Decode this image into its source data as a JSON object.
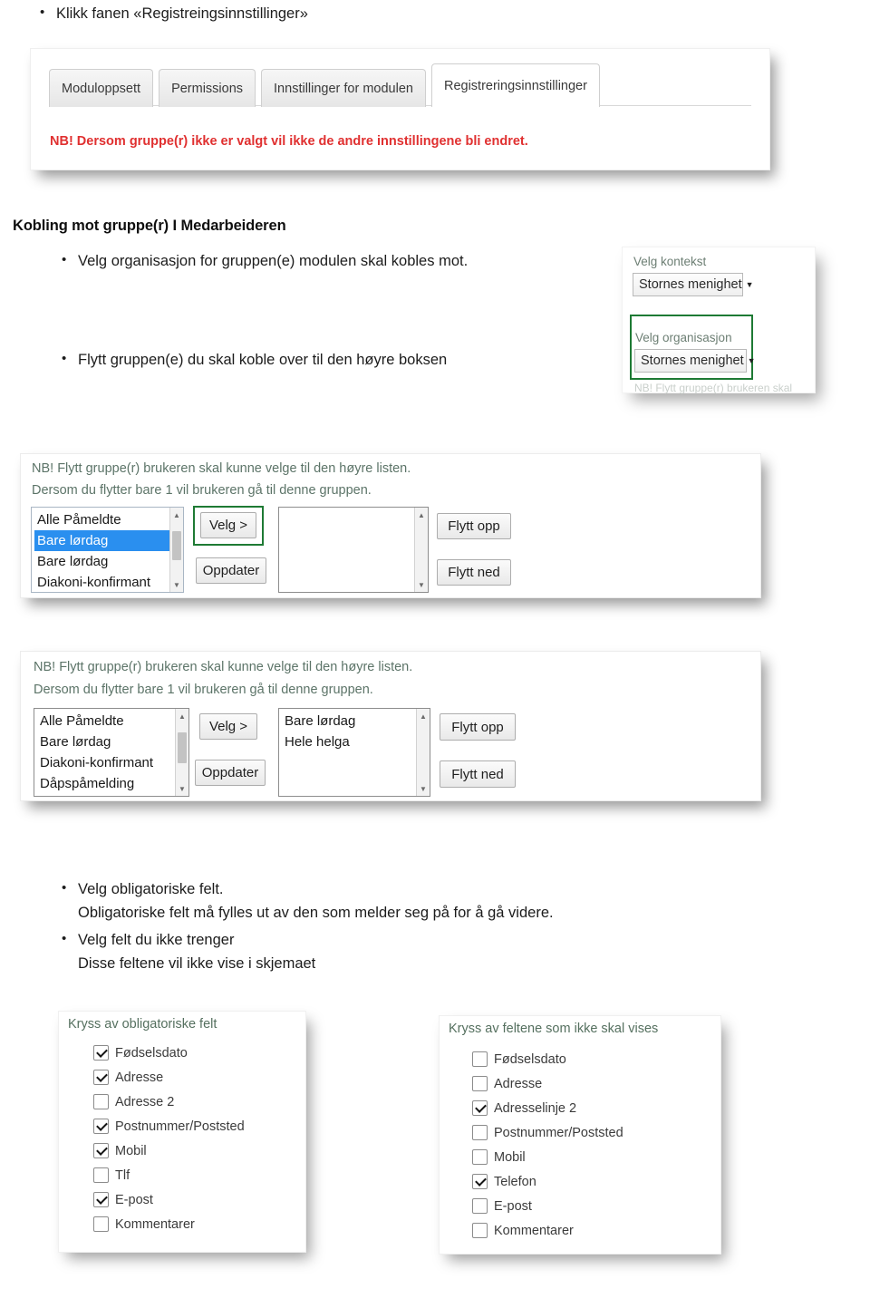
{
  "doc": {
    "bullet_click_tab": "Klikk fanen «Registreingsinnstillinger»",
    "heading_kobling": "Kobling mot gruppe(r) I Medarbeideren",
    "bullet_velg_org": "Velg organisasjon for gruppen(e) modulen skal kobles mot.",
    "bullet_flytt_gruppe": "Flytt gruppen(e) du skal koble over til den høyre boksen",
    "bullet_velg_obligatoriske": "Velg obligatoriske felt.",
    "text_obligatoriske_forklaring": "Obligatoriske felt må fylles ut av den som melder seg på for å gå videre.",
    "bullet_velg_ikke_trenger": "Velg felt du ikke trenger",
    "text_ikke_vise": "Disse feltene vil ikke vise i skjemaet",
    "bullet_glyph": "•"
  },
  "tab_screenshot": {
    "tabs": [
      {
        "label": "Moduloppsett",
        "active": false
      },
      {
        "label": "Permissions",
        "active": false
      },
      {
        "label": "Innstillinger for modulen",
        "active": false
      },
      {
        "label": "Registreringsinnstillinger",
        "active": true
      }
    ],
    "warning": "NB! Dersom gruppe(r) ikke er valgt vil ikke de andre innstillingene bli endret.",
    "warning_color": "#e03030"
  },
  "select_screenshot": {
    "context_label": "Velg kontekst",
    "context_value": "Stornes menighet",
    "organisation_label": "Velg organisasjon",
    "organisation_value": "Stornes menighet",
    "caret_glyph": "▼",
    "highlight_color": "#1e7a34",
    "cut_off_text": "NB! Flytt gruppe(r) brukeren skal"
  },
  "picker_one": {
    "note_line_1": "NB! Flytt gruppe(r) brukeren skal kunne velge til den høyre listen.",
    "note_line_2": "Dersom du flytter bare 1 vil brukeren gå til denne gruppen.",
    "left_items": [
      {
        "label": "Alle Påmeldte",
        "selected": false
      },
      {
        "label": "Bare lørdag",
        "selected": true
      },
      {
        "label": "Bare lørdag",
        "selected": false
      },
      {
        "label": "Diakoni-konfirmant",
        "selected": false
      }
    ],
    "right_items": [],
    "select_button": "Velg >",
    "update_button": "Oppdater",
    "move_up_button": "Flytt opp",
    "move_down_button": "Flytt ned",
    "selection_color": "#2a8fef",
    "highlight_color": "#1e7a34",
    "scroll_up_glyph": "▲",
    "scroll_down_glyph": "▼"
  },
  "picker_two": {
    "note_line_1": "NB! Flytt gruppe(r) brukeren skal kunne velge til den høyre listen.",
    "note_line_2": "Dersom du flytter bare 1 vil brukeren gå til denne gruppen.",
    "left_items": [
      {
        "label": "Alle Påmeldte",
        "selected": false
      },
      {
        "label": "Bare lørdag",
        "selected": false
      },
      {
        "label": "Diakoni-konfirmant",
        "selected": false
      },
      {
        "label": "Dåpspåmelding",
        "selected": false
      }
    ],
    "right_items": [
      {
        "label": "Bare lørdag",
        "selected": false
      },
      {
        "label": "Hele helga",
        "selected": false
      }
    ],
    "select_button": "Velg >",
    "update_button": "Oppdater",
    "move_up_button": "Flytt opp",
    "move_down_button": "Flytt ned",
    "scroll_up_glyph": "▲",
    "scroll_down_glyph": "▼"
  },
  "required_fields_panel": {
    "title": "Kryss av obligatoriske felt",
    "items": [
      {
        "label": "Fødselsdato",
        "checked": true
      },
      {
        "label": "Adresse",
        "checked": true
      },
      {
        "label": "Adresse 2",
        "checked": false
      },
      {
        "label": "Postnummer/Poststed",
        "checked": true
      },
      {
        "label": "Mobil",
        "checked": true
      },
      {
        "label": "Tlf",
        "checked": false
      },
      {
        "label": "E-post",
        "checked": true
      },
      {
        "label": "Kommentarer",
        "checked": false
      }
    ]
  },
  "hidden_fields_panel": {
    "title": "Kryss av feltene som ikke skal vises",
    "items": [
      {
        "label": "Fødselsdato",
        "checked": false
      },
      {
        "label": "Adresse",
        "checked": false
      },
      {
        "label": "Adresselinje 2",
        "checked": true
      },
      {
        "label": "Postnummer/Poststed",
        "checked": false
      },
      {
        "label": "Mobil",
        "checked": false
      },
      {
        "label": "Telefon",
        "checked": true
      },
      {
        "label": "E-post",
        "checked": false
      },
      {
        "label": "Kommentarer",
        "checked": false
      }
    ]
  }
}
